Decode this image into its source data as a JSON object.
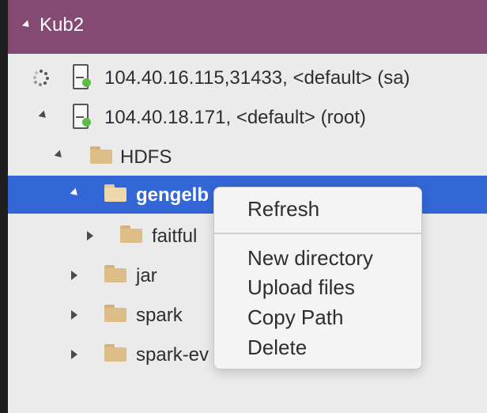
{
  "header": {
    "title": "Kub2"
  },
  "tree": {
    "servers": [
      {
        "label": "104.40.16.115,31433, <default> (sa)",
        "state": "loading"
      },
      {
        "label": "104.40.18.171, <default> (root)",
        "state": "expanded"
      }
    ],
    "hdfs": {
      "label": "HDFS"
    },
    "folders": [
      {
        "label": "gengelb",
        "selected": true
      },
      {
        "label": "faitful"
      },
      {
        "label": "jar"
      },
      {
        "label": "spark"
      },
      {
        "label": "spark-ev"
      }
    ]
  },
  "context_menu": {
    "items": [
      {
        "label": "Refresh"
      },
      {
        "label": "New directory"
      },
      {
        "label": "Upload files"
      },
      {
        "label": "Copy Path"
      },
      {
        "label": "Delete"
      }
    ]
  },
  "colors": {
    "header_bg": "#854a74",
    "selection": "#3367d6",
    "connected_dot": "#5dbb46",
    "folder": "#ddbd88"
  }
}
